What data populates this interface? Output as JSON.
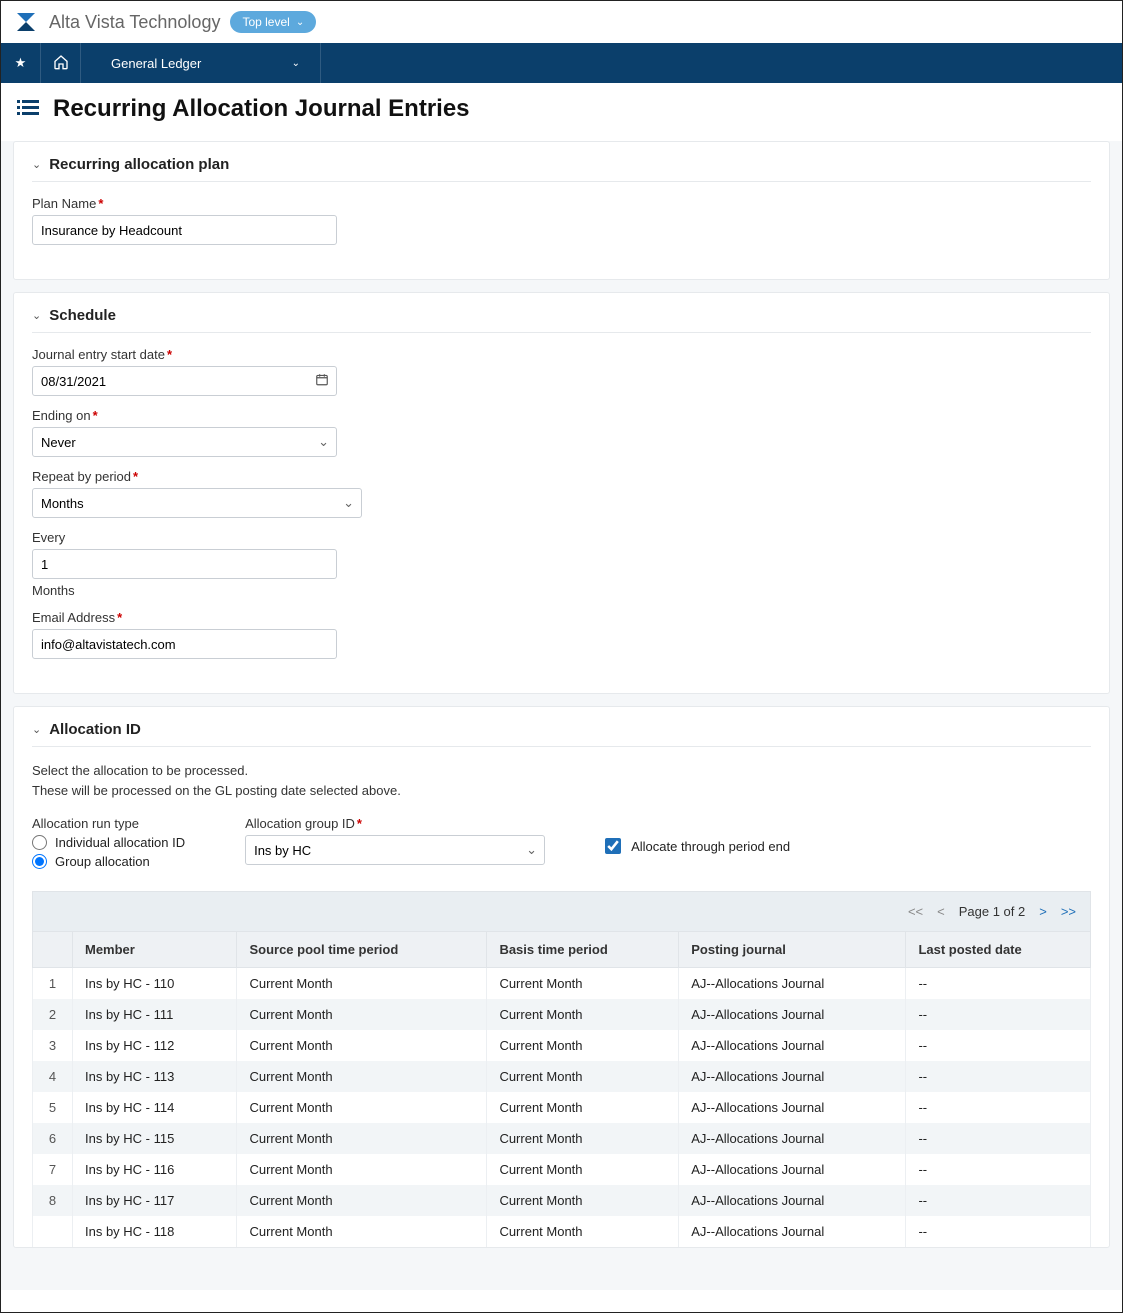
{
  "header": {
    "company": "Alta Vista Technology",
    "top_level_label": "Top level"
  },
  "nav": {
    "module": "General Ledger"
  },
  "page": {
    "title": "Recurring Allocation Journal Entries"
  },
  "plan_section": {
    "title": "Recurring allocation plan",
    "plan_name_label": "Plan Name",
    "plan_name_value": "Insurance by Headcount"
  },
  "schedule_section": {
    "title": "Schedule",
    "start_date_label": "Journal entry start date",
    "start_date_value": "08/31/2021",
    "ending_on_label": "Ending on",
    "ending_on_value": "Never",
    "repeat_by_label": "Repeat by period",
    "repeat_by_value": "Months",
    "every_label": "Every",
    "every_value": "1",
    "every_unit": "Months",
    "email_label": "Email Address",
    "email_value": "info@altavistatech.com"
  },
  "allocation_section": {
    "title": "Allocation ID",
    "help1": "Select the allocation to be processed.",
    "help2": "These will be processed on the GL posting date selected above.",
    "run_type_label": "Allocation run type",
    "run_type_individual": "Individual allocation ID",
    "run_type_group": "Group allocation",
    "run_type_selected": "group",
    "group_id_label": "Allocation group ID",
    "group_id_value": "Ins by HC",
    "allocate_through_label": "Allocate through period end",
    "allocate_through_checked": true
  },
  "table": {
    "pager": {
      "page_text": "Page 1 of 2"
    },
    "columns": [
      "Member",
      "Source pool time period",
      "Basis time period",
      "Posting journal",
      "Last posted date"
    ],
    "rows": [
      {
        "n": "1",
        "member": "Ins by HC - 110",
        "source": "Current Month",
        "basis": "Current Month",
        "journal": "AJ--Allocations Journal",
        "last": "--"
      },
      {
        "n": "2",
        "member": "Ins by HC - 111",
        "source": "Current Month",
        "basis": "Current Month",
        "journal": "AJ--Allocations Journal",
        "last": "--"
      },
      {
        "n": "3",
        "member": "Ins by HC - 112",
        "source": "Current Month",
        "basis": "Current Month",
        "journal": "AJ--Allocations Journal",
        "last": "--"
      },
      {
        "n": "4",
        "member": "Ins by HC - 113",
        "source": "Current Month",
        "basis": "Current Month",
        "journal": "AJ--Allocations Journal",
        "last": "--"
      },
      {
        "n": "5",
        "member": "Ins by HC - 114",
        "source": "Current Month",
        "basis": "Current Month",
        "journal": "AJ--Allocations Journal",
        "last": "--"
      },
      {
        "n": "6",
        "member": "Ins by HC - 115",
        "source": "Current Month",
        "basis": "Current Month",
        "journal": "AJ--Allocations Journal",
        "last": "--"
      },
      {
        "n": "7",
        "member": "Ins by HC - 116",
        "source": "Current Month",
        "basis": "Current Month",
        "journal": "AJ--Allocations Journal",
        "last": "--"
      },
      {
        "n": "8",
        "member": "Ins by HC - 117",
        "source": "Current Month",
        "basis": "Current Month",
        "journal": "AJ--Allocations Journal",
        "last": "--"
      },
      {
        "n": "",
        "member": "Ins by HC - 118",
        "source": "Current Month",
        "basis": "Current Month",
        "journal": "AJ--Allocations Journal",
        "last": "--"
      }
    ]
  }
}
